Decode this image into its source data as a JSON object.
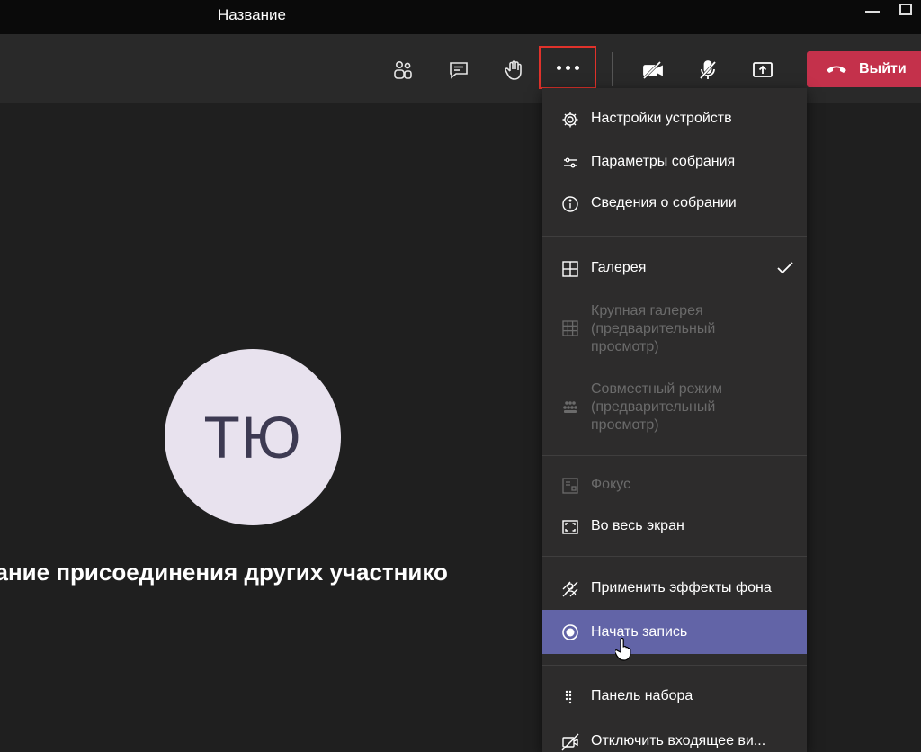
{
  "window": {
    "title": "Название"
  },
  "toolbar": {
    "participants_icon": "people-icon",
    "chat_icon": "chat-icon",
    "raise_hand_icon": "hand-icon",
    "more_icon": "more-dots-icon",
    "camera_icon": "camera-off-icon",
    "mic_icon": "mic-off-icon",
    "share_icon": "share-screen-icon",
    "leave_label": "Выйти"
  },
  "stage": {
    "avatar_initials": "ТЮ",
    "waiting_text": "дание присоединения других участнико"
  },
  "menu": {
    "device_settings": "Настройки устройств",
    "meeting_options": "Параметры собрания",
    "meeting_info": "Сведения о собрании",
    "gallery": "Галерея",
    "large_gallery_1": "Крупная галерея",
    "large_gallery_2": "(предварительный",
    "large_gallery_3": "просмотр)",
    "together_mode_1": "Совместный режим",
    "together_mode_2": "(предварительный",
    "together_mode_3": "просмотр)",
    "focus": "Фокус",
    "fullscreen": "Во весь экран",
    "background_effects": "Применить эффекты фона",
    "start_recording": "Начать запись",
    "dial_pad": "Панель набора",
    "turn_off_incoming_video": "Отключить входящее ви..."
  },
  "colors": {
    "leave_red": "#c4314b",
    "menu_active": "#6264a7",
    "highlight_border": "#e0322b"
  }
}
